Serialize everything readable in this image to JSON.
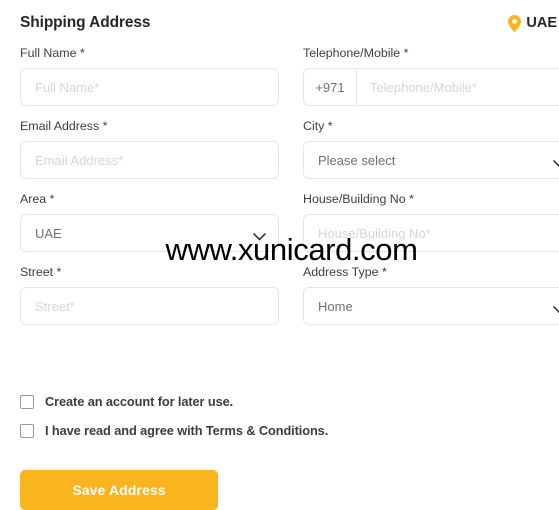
{
  "header": {
    "title": "Shipping Address",
    "country_label": "UAE",
    "pin_icon": "location-pin-icon",
    "accent_color": "#fab41e"
  },
  "form": {
    "rows": [
      {
        "left": {
          "label": "Full Name *",
          "placeholder": "Full Name*",
          "value": "",
          "type": "text"
        },
        "right": {
          "label": "Telephone/Mobile *",
          "placeholder": "Telephone/Mobile*",
          "value": "",
          "prefix": "+971",
          "type": "phone"
        }
      },
      {
        "left": {
          "label": "Email Address *",
          "placeholder": "Email Address*",
          "value": "",
          "type": "text"
        },
        "right": {
          "label": "City *",
          "placeholder": "Please select",
          "value": "Please select",
          "type": "select"
        }
      },
      {
        "left": {
          "label": "Area *",
          "placeholder": "UAE",
          "value": "UAE",
          "type": "select"
        },
        "right": {
          "label": "House/Building No *",
          "placeholder": "House/Building No*",
          "value": "",
          "type": "text"
        }
      },
      {
        "left": {
          "label": "Street *",
          "placeholder": "Street*",
          "value": "",
          "type": "text"
        },
        "right": {
          "label": "Address Type *",
          "placeholder": "Home",
          "value": "Home",
          "type": "select"
        }
      }
    ]
  },
  "checkboxes": [
    {
      "label": "Create an account for later use.",
      "checked": false
    },
    {
      "label": "I have read and agree with Terms & Conditions.",
      "checked": false
    }
  ],
  "actions": {
    "save_label": "Save Address"
  },
  "watermark": {
    "text": "www.xunicard.com"
  }
}
